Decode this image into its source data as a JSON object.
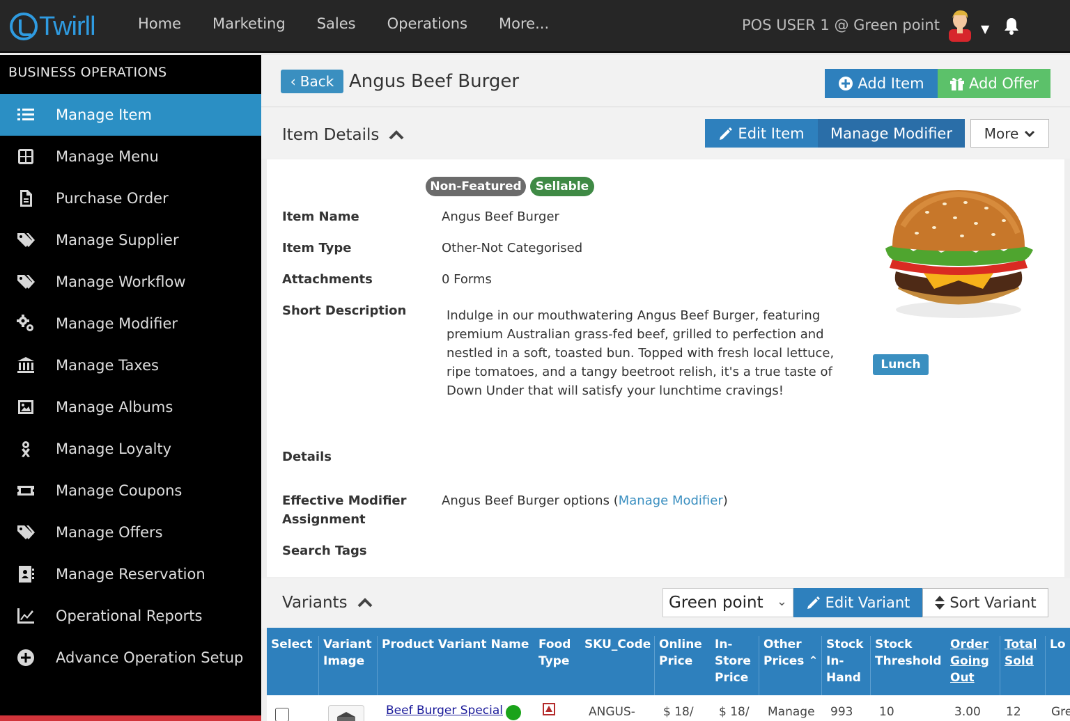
{
  "app": {
    "logo_text": "Twirll",
    "nav": [
      "Home",
      "Marketing",
      "Sales",
      "Operations",
      "More..."
    ],
    "user": "POS USER 1 @ Green point"
  },
  "sidebar": {
    "title": "BUSINESS OPERATIONS",
    "items": [
      {
        "label": "Manage Item",
        "icon": "list-icon",
        "active": true
      },
      {
        "label": "Manage Menu",
        "icon": "grid-icon"
      },
      {
        "label": "Purchase Order",
        "icon": "file-icon"
      },
      {
        "label": "Manage Supplier",
        "icon": "tags-icon"
      },
      {
        "label": "Manage Workflow",
        "icon": "tags-icon"
      },
      {
        "label": "Manage Modifier",
        "icon": "cogs-icon"
      },
      {
        "label": "Manage Taxes",
        "icon": "bank-icon"
      },
      {
        "label": "Manage Albums",
        "icon": "image-icon"
      },
      {
        "label": "Manage Loyalty",
        "icon": "loyalty-icon"
      },
      {
        "label": "Manage Coupons",
        "icon": "ticket-icon"
      },
      {
        "label": "Manage Offers",
        "icon": "tags-icon"
      },
      {
        "label": "Manage Reservation",
        "icon": "address-book-icon"
      },
      {
        "label": "Operational Reports",
        "icon": "chart-icon"
      },
      {
        "label": "Advance Operation Setup",
        "icon": "plus-circle-icon"
      }
    ]
  },
  "header": {
    "back": "Back",
    "title": "Angus Beef Burger",
    "add_item": "Add Item",
    "add_offer": "Add Offer"
  },
  "details": {
    "section_title": "Item Details",
    "edit_item": "Edit Item",
    "manage_modifier": "Manage Modifier",
    "more": "More",
    "badges": [
      "Non-Featured",
      "Sellable"
    ],
    "item_name_label": "Item Name",
    "item_name": "Angus Beef Burger",
    "item_type_label": "Item Type",
    "item_type": "Other-Not Categorised",
    "attachments_label": "Attachments",
    "attachments": "0 Forms",
    "short_desc_label": "Short Description",
    "short_desc": "Indulge in our mouthwatering Angus Beef Burger, featuring premium Australian grass-fed beef, grilled to perfection and nestled in a soft, toasted bun. Topped with fresh local lettuce, ripe tomatoes, and a tangy beetroot relish, it's a true taste of Down Under that will satisfy your lunchtime cravings!",
    "details_label": "Details",
    "modifier_label_1": "Effective Modifier",
    "modifier_label_2": "Assignment",
    "modifier_text": "Angus Beef Burger options (",
    "modifier_link": "Manage Modifier",
    "modifier_close": ")",
    "search_tags_label": "Search Tags",
    "tag": "Lunch"
  },
  "variants": {
    "section_title": "Variants",
    "location": "Green point",
    "edit_variant": "Edit Variant",
    "sort_variant": "Sort Variant",
    "columns": {
      "select": "Select",
      "variant_image_1": "Variant",
      "variant_image_2": "Image",
      "name": "Product Variant Name",
      "food_1": "Food",
      "food_2": "Type",
      "sku": "SKU_Code",
      "online_1": "Online",
      "online_2": "Price",
      "instore_1": "In-",
      "instore_2": "Store",
      "instore_3": "Price",
      "other_1": "Other",
      "other_2": "Prices",
      "stock_1": "Stock",
      "stock_2": "In-",
      "stock_3": "Hand",
      "threshold_1": "Stock",
      "threshold_2": "Threshold",
      "order_1": "Order",
      "order_2": "Going",
      "order_3": "Out",
      "total_1": "Total",
      "total_2": "Sold",
      "lo": "Lo"
    },
    "rows": [
      {
        "name": "Beef Burger Special",
        "sku": "ANGUS-",
        "online": "$ 18/",
        "instore": "$ 18/",
        "other": "Manage",
        "stock": "993",
        "threshold": "10",
        "order": "3.00",
        "sold": "12",
        "loc": "Gre"
      }
    ]
  },
  "colors": {
    "primary": "#2e80bd",
    "active_sidebar": "#2b8fc4",
    "offer_green": "#5cc16a",
    "sellable": "#3f8a45"
  }
}
